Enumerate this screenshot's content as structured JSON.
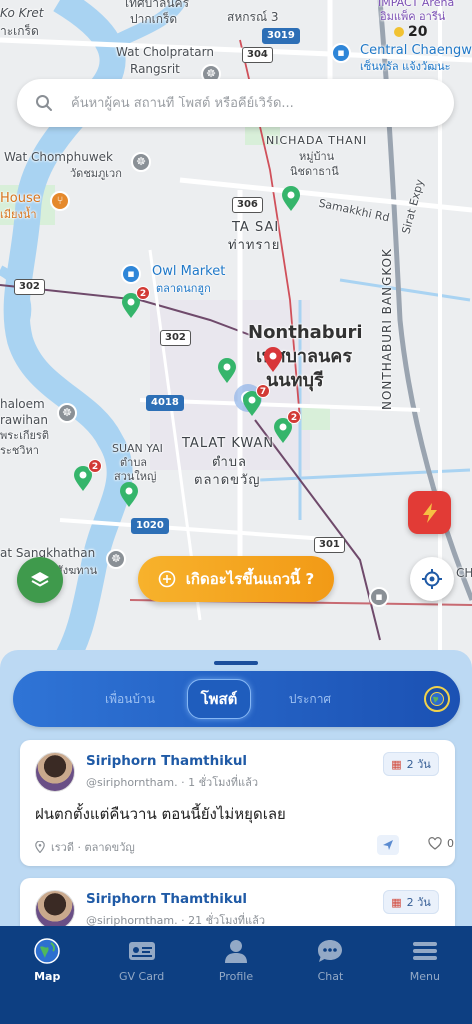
{
  "search": {
    "placeholder": "ค้นหาผู้คน สถานที่ โพสต์ หรือคีย์เวิร์ด..."
  },
  "map": {
    "labels": {
      "ko_kret": "Ko Kret",
      "ko_kret_th": "าะเกร็ด",
      "pak_kret_th": "เทศบาลนคร",
      "pak_kret_th2": "ปากเกร็ด",
      "sahakorn": "สหกรณ์ 3",
      "impact": "IMPACT Arena",
      "impact_th": "อิมแพ็ค อารีน่",
      "wat_cholpratarn": "Wat Cholpratarn",
      "rangsrit": "Rangsrit",
      "central": "Central Chaengwa",
      "central_th": "เซ็นทรัล แจ้งวัฒนะ",
      "chada_thani": "NICHADA THANI",
      "chada_thani_th": "หมู่บ้าน",
      "chada_thani_th2": "นิชดาธานี",
      "wat_chomphuwek": "Wat Chomphuwek",
      "wat_chomphuwek_th": "วัดชมภูเวก",
      "house": "House",
      "house_th": "เมียงน้ำ",
      "samakkhi": "Samakkhi Rd",
      "sirat": "Sirat Expy",
      "ta_sai": "TA SAI",
      "ta_sai_th": "ท่าทราย",
      "owl_market": "Owl Market",
      "owl_market_th": "ตลาดนกฮูก",
      "nonthaburi": "Nonthaburi",
      "nonthaburi_th": "เทศบาลนคร",
      "nonthaburi_th2": "นนทบุรี",
      "nonthaburi_bangkok": "NONTHABURI BANGKOK",
      "chaloem": "haloem",
      "rawihan": "rawihan",
      "rawihan_th": "พระเกียรติ",
      "rawihan_th2": "ระชวิหา",
      "suan_yai": "SUAN YAI",
      "suan_yai_th": "ตำบล",
      "suan_yai_th2": "สวนใหญ่",
      "talat_kwan": "TALAT KWAN",
      "talat_kwan_th": "ตำบล",
      "talat_kwan_th2": "ตลาดขวัญ",
      "sangkhathan": "at Sangkhathan",
      "sangkhathan_th": "สังฆทาน",
      "ch": "CH"
    },
    "shields": {
      "r3019": "3019",
      "r304": "304",
      "r306": "306",
      "r302a": "302",
      "r302b": "302",
      "r4018": "4018",
      "r1020": "1020",
      "r301": "301"
    },
    "badges": {
      "b1": "2",
      "b2": "7",
      "b3": "2",
      "b4": "2"
    },
    "corner_count": "20",
    "happening_label": "เกิดอะไรขึ้นแถวนี้ ?",
    "colors": {
      "accent_green": "#3f9a4c",
      "accent_orange": "#f29a16",
      "accent_red": "#e23b36",
      "pin_green": "#35b56b",
      "pin_red": "#d8363a"
    }
  },
  "segments": {
    "neighbors": "เพื่อนบ้าน",
    "posts": "โพสต์",
    "announce": "ประกาศ"
  },
  "posts": [
    {
      "author": "Siriphorn Thamthikul",
      "handle": "@siriphorntham.",
      "time": "1 ชั่วโมงที่แล้ว",
      "duration": "2 วัน",
      "text": "ฝนตกตั้งแต่คืนวาน ตอนนี้ยังไม่หยุดเลย",
      "location": "เรวดี · ตลาดขวัญ",
      "likes": "0"
    },
    {
      "author": "Siriphorn Thamthikul",
      "handle": "@siriphorntham.",
      "time": "21 ชั่วโมงที่แล้ว",
      "duration": "2 วัน"
    }
  ],
  "tabs": [
    {
      "label": "Map",
      "icon": "globe-icon"
    },
    {
      "label": "GV Card",
      "icon": "id-card-icon"
    },
    {
      "label": "Profile",
      "icon": "person-icon"
    },
    {
      "label": "Chat",
      "icon": "chat-icon"
    },
    {
      "label": "Menu",
      "icon": "menu-icon"
    }
  ]
}
